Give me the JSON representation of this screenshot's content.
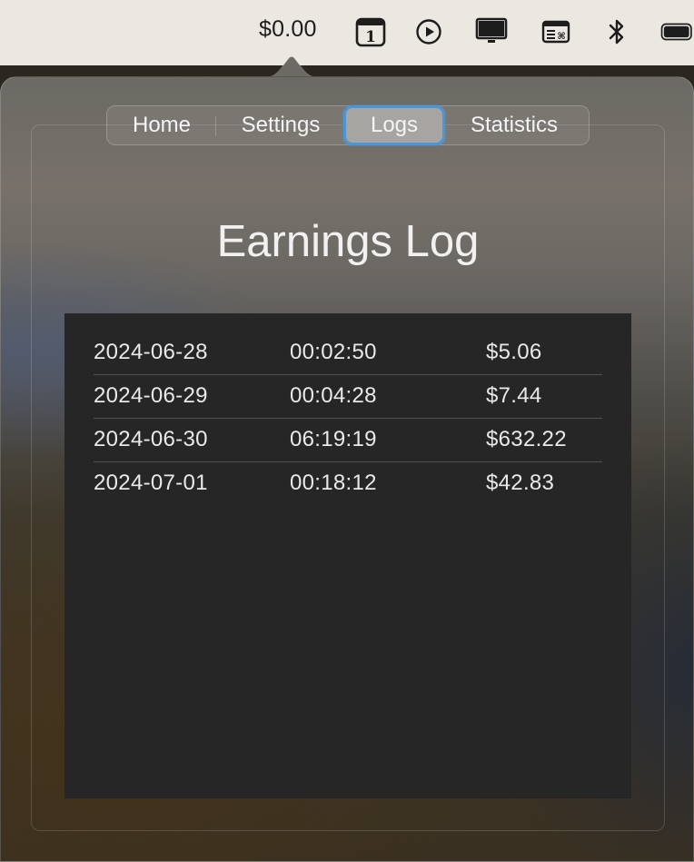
{
  "menubar": {
    "amount": "$0.00",
    "calendar_day": "1",
    "icons": [
      "calendar-icon",
      "play-icon",
      "display-icon",
      "keyboard-shortcut-icon",
      "bluetooth-icon",
      "battery-icon"
    ]
  },
  "tabs": [
    {
      "label": "Home",
      "selected": false
    },
    {
      "label": "Settings",
      "selected": false
    },
    {
      "label": "Logs",
      "selected": true
    },
    {
      "label": "Statistics",
      "selected": false
    }
  ],
  "page": {
    "title": "Earnings Log"
  },
  "logs": [
    {
      "date": "2024-06-28",
      "duration": "00:02:50",
      "amount": "$5.06"
    },
    {
      "date": "2024-06-29",
      "duration": "00:04:28",
      "amount": "$7.44"
    },
    {
      "date": "2024-06-30",
      "duration": "06:19:19",
      "amount": "$632.22"
    },
    {
      "date": "2024-07-01",
      "duration": "00:18:12",
      "amount": "$42.83"
    }
  ],
  "colors": {
    "accent": "#4b95d9",
    "table_bg": "#262626"
  }
}
